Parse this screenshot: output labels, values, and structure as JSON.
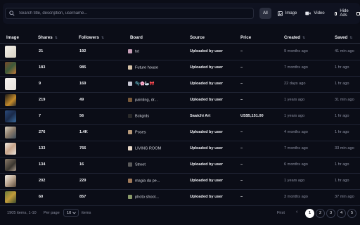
{
  "search": {
    "placeholder": "Search title, description, username..."
  },
  "filters": {
    "all": "All",
    "image": "Image",
    "video": "Video",
    "hide_ads": "Hide Ads"
  },
  "table": {
    "headers": [
      "Image",
      "Shares",
      "Followers",
      "Board",
      "Source",
      "Price",
      "Created",
      "Saved"
    ],
    "sort_icon": "⇅",
    "rows": [
      {
        "shares": "21",
        "followers": "192",
        "board": "txt",
        "source": "Uploaded by user",
        "price": "–",
        "created": "9 months ago",
        "saved": "41 min ago"
      },
      {
        "shares": "183",
        "followers": "985",
        "board": "Future house",
        "source": "Uploaded by user",
        "price": "–",
        "created": "7 months ago",
        "saved": "1 hr ago"
      },
      {
        "shares": "9",
        "followers": "169",
        "board": "🫧🌸🦢🎀",
        "source": "Uploaded by user",
        "price": "–",
        "created": "22 days ago",
        "saved": "1 hr ago"
      },
      {
        "shares": "219",
        "followers": "49",
        "board": "painting, dr...",
        "source": "Uploaded by user",
        "price": "–",
        "created": "1 years ago",
        "saved": "31 min ago"
      },
      {
        "shares": "7",
        "followers": "56",
        "board": "Bckgrds",
        "source": "Saatchi Art",
        "price": "US$5,151.00",
        "created": "1 years ago",
        "saved": "1 hr ago"
      },
      {
        "shares": "276",
        "followers": "1.4K",
        "board": "Poses",
        "source": "Uploaded by user",
        "price": "–",
        "created": "4 months ago",
        "saved": "1 hr ago"
      },
      {
        "shares": "133",
        "followers": "766",
        "board": "LIVING ROOM",
        "source": "Uploaded by user",
        "price": "–",
        "created": "7 months ago",
        "saved": "33 min ago"
      },
      {
        "shares": "134",
        "followers": "16",
        "board": "Street",
        "source": "Uploaded by user",
        "price": "–",
        "created": "6 months ago",
        "saved": "1 hr ago"
      },
      {
        "shares": "202",
        "followers": "229",
        "board": "magia da pe...",
        "source": "Uploaded by user",
        "price": "–",
        "created": "1 years ago",
        "saved": "1 hr ago"
      },
      {
        "shares": "60",
        "followers": "857",
        "board": "photo shoot...",
        "source": "Uploaded by user",
        "price": "–",
        "created": "3 months ago",
        "saved": "37 min ago"
      }
    ]
  },
  "footer": {
    "items": "1905 items, 1-10",
    "per_page_label": "Per page",
    "per_page_value": "10",
    "items_label": "items",
    "first": "First",
    "prev": "‹",
    "pages": [
      "1",
      "2",
      "3",
      "4",
      "5"
    ]
  },
  "colors": {
    "background": "#0b0d17",
    "active_page": "#ffffff"
  },
  "icons": [
    "search-icon",
    "image-icon",
    "video-icon",
    "chevron-down-icon",
    "checkbox-icon"
  ]
}
